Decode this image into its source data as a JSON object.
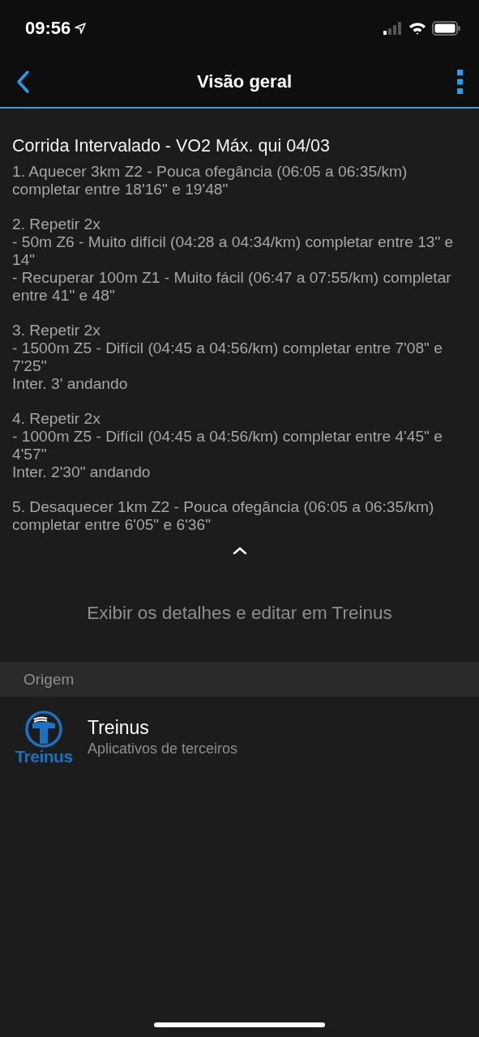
{
  "status_bar": {
    "time": "09:56"
  },
  "nav": {
    "title": "Visão geral"
  },
  "workout": {
    "title": "Corrida Intervalado - VO2 Máx. qui 04/03",
    "steps": [
      {
        "lines": [
          "1. Aquecer 3km Z2 - Pouca ofegância (06:05 a 06:35/km) completar entre 18'16\" e 19'48\""
        ]
      },
      {
        "lines": [
          "2. Repetir 2x",
          "- 50m Z6 - Muito difícil (04:28 a 04:34/km) completar entre 13\" e 14\"",
          "- Recuperar 100m Z1 - Muito fácil (06:47 a 07:55/km) completar entre 41\" e 48\""
        ]
      },
      {
        "lines": [
          "3. Repetir 2x",
          "- 1500m Z5 - Difícil (04:45 a 04:56/km) completar entre 7'08\" e 7'25\"",
          "Inter. 3' andando"
        ]
      },
      {
        "lines": [
          "4. Repetir 2x",
          "- 1000m Z5 - Difícil (04:45 a 04:56/km) completar entre 4'45\" e 4'57\"",
          "Inter. 2'30\" andando"
        ]
      },
      {
        "lines": [
          "5. Desaquecer 1km Z2 - Pouca ofegância (06:05 a 06:35/km) completar entre 6'05\" e 6'36\""
        ]
      }
    ],
    "expanded": true,
    "details_link": "Exibir os detalhes e editar em Treinus"
  },
  "origin": {
    "header": "Origem",
    "logo_text": "Treinus",
    "name": "Treinus",
    "subtitle": "Aplicativos de terceiros"
  }
}
